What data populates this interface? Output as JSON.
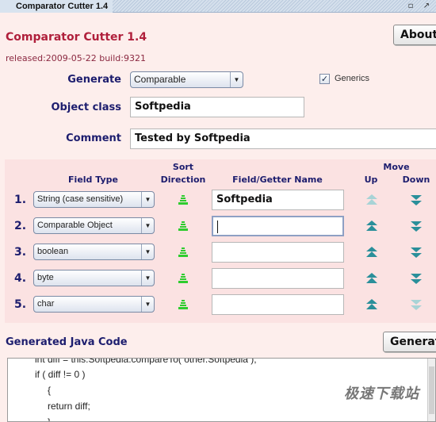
{
  "window": {
    "title": "Comparator Cutter 1.4",
    "restore_icon": "restore-icon",
    "maximize_icon": "maximize-icon"
  },
  "header": {
    "app_title": "Comparator Cutter 1.4",
    "release_info": "released:2009-05-22 build:9321",
    "about_label": "About"
  },
  "form": {
    "generate_label": "Generate",
    "generate_value": "Comparable",
    "generics_label": "Generics",
    "generics_checked": true,
    "object_class_label": "Object class",
    "object_class_value": "Softpedia",
    "comment_label": "Comment",
    "comment_value": "Tested by Softpedia"
  },
  "fields_table": {
    "headers": {
      "field_type": "Field Type",
      "sort": "Sort",
      "direction": "Direction",
      "field_getter": "Field/Getter Name",
      "move": "Move",
      "up": "Up",
      "down": "Down"
    },
    "rows": [
      {
        "num": "1.",
        "type": "String (case sensitive)",
        "name": "Softpedia",
        "up_enabled": false,
        "down_enabled": true
      },
      {
        "num": "2.",
        "type": "Comparable Object",
        "name": "",
        "up_enabled": true,
        "down_enabled": true,
        "focused": true
      },
      {
        "num": "3.",
        "type": "boolean",
        "name": "",
        "up_enabled": true,
        "down_enabled": true
      },
      {
        "num": "4.",
        "type": "byte",
        "name": "",
        "up_enabled": true,
        "down_enabled": true
      },
      {
        "num": "5.",
        "type": "char",
        "name": "",
        "up_enabled": true,
        "down_enabled": false
      }
    ]
  },
  "code": {
    "section_title": "Generated Java Code",
    "generate_button": "Generate",
    "lines": [
      "int diff = this.Softpedia.compareTo( other.Softpedia );",
      "if ( diff != 0 )",
      "{",
      "return diff;",
      "}"
    ],
    "watermark": "极速下载站"
  },
  "colors": {
    "background": "#fdeeec",
    "panel": "#fbe2e2",
    "title_red": "#b0203c",
    "label_navy": "#1d1d6e",
    "sort_green": "#2ecc2e",
    "move_teal": "#2a8f9a"
  }
}
